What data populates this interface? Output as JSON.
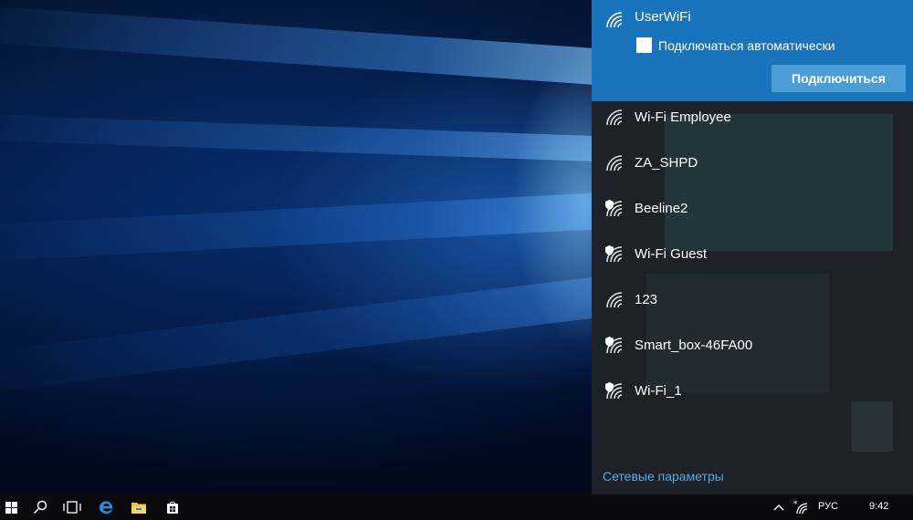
{
  "wifi_flyout": {
    "selected": {
      "ssid": "UserWiFi",
      "auto_connect_label": "Подключаться автоматически",
      "auto_connect_checked": false,
      "connect_label": "Подключиться"
    },
    "networks": [
      {
        "ssid": "Wi-Fi Employee",
        "secured": false
      },
      {
        "ssid": "ZA_SHPD",
        "secured": false
      },
      {
        "ssid": "Beeline2",
        "secured": true
      },
      {
        "ssid": "Wi-Fi Guest",
        "secured": true
      },
      {
        "ssid": "123",
        "secured": false
      },
      {
        "ssid": "Smart_box-46FA00",
        "secured": true
      },
      {
        "ssid": "Wi-Fi_1",
        "secured": true
      }
    ],
    "settings_link": "Сетевые параметры"
  },
  "taskbar": {
    "icons": [
      "start-icon",
      "search-icon",
      "task-view-icon",
      "edge-icon",
      "file-explorer-icon",
      "store-icon"
    ],
    "tray": {
      "language": "РУС",
      "time": "9:42"
    }
  },
  "colors": {
    "accent": "#1a74bb",
    "button": "#4b9dd8",
    "link": "#56a8e4",
    "panel": "#1c2228",
    "taskbar": "#0a0a0c"
  }
}
